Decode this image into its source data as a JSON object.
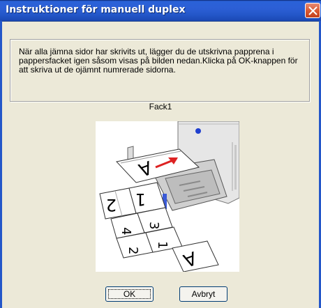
{
  "window": {
    "title": "Instruktioner för manuell duplex",
    "accent": "#2457c9",
    "close_color": "#d9572f"
  },
  "message": "När alla jämna sidor har skrivits ut, lägger du de utskrivna papprena i pappersfacket igen såsom visas på bilden nedan.Klicka på OK-knappen för att skriva ut de ojämnt numrerade sidorna.",
  "tray": {
    "label": "Fack1"
  },
  "illustration": {
    "icon": "printer-tray-illustration",
    "page_glyphs": [
      "A",
      "1",
      "2",
      "3",
      "4",
      "2",
      "1",
      "A"
    ]
  },
  "buttons": {
    "ok_label": "OK",
    "cancel_label": "Avbryt"
  }
}
